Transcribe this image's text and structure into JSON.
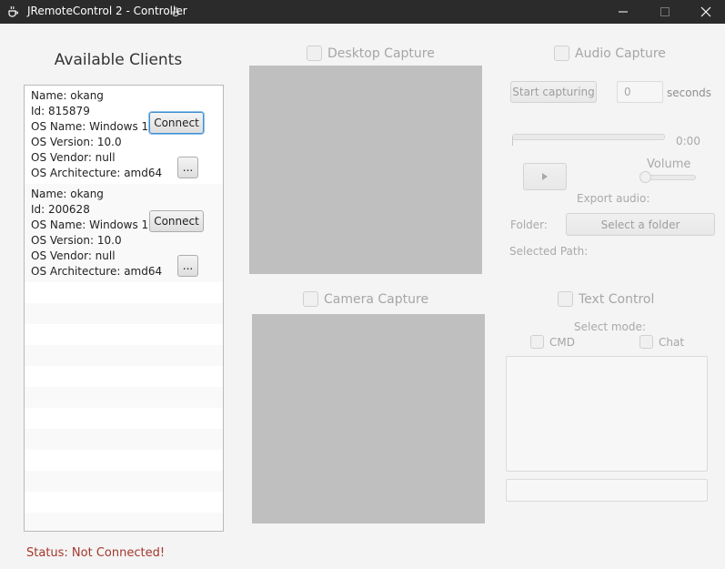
{
  "window": {
    "title": "JRemoteControl 2 - Controller",
    "minimize_glyph": "—",
    "maximize_glyph": "☐",
    "close_glyph": "✕"
  },
  "clients_panel": {
    "title": "Available Clients",
    "clients": [
      {
        "name": "Name: okang",
        "id": "Id: 815879",
        "os_name": "OS Name: Windows 10",
        "os_version": "OS Version: 10.0",
        "os_vendor": "OS Vendor: null",
        "os_arch": "OS Architecture: amd64",
        "connect_label": "Connect",
        "more_label": "..."
      },
      {
        "name": "Name: okang",
        "id": "Id: 200628",
        "os_name": "OS Name: Windows 10",
        "os_version": "OS Version: 10.0",
        "os_vendor": "OS Vendor: null",
        "os_arch": "OS Architecture: amd64",
        "connect_label": "Connect",
        "more_label": "..."
      }
    ],
    "status": "Status: Not Connected!"
  },
  "desktop_capture": {
    "label": "Desktop Capture"
  },
  "camera_capture": {
    "label": "Camera Capture"
  },
  "audio_capture": {
    "label": "Audio Capture",
    "start_label": "Start capturing",
    "seconds_value": "0",
    "seconds_label": "seconds",
    "time": "0:00",
    "play_glyph": "▸",
    "volume_label": "Volume",
    "export_label": "Export audio:",
    "folder_label": "Folder:",
    "select_folder_label": "Select a folder",
    "selected_path_label": "Selected Path:"
  },
  "text_control": {
    "label": "Text Control",
    "select_mode_label": "Select mode:",
    "cmd_label": "CMD",
    "chat_label": "Chat"
  },
  "colors": {
    "titlebar": "#2b2b2b",
    "status": "#a4372b",
    "capture_area": "#bfbfbf"
  }
}
